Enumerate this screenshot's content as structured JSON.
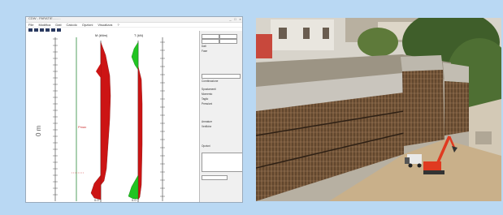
{
  "app": {
    "window_title": "CDW - PARATIE.........",
    "menu": [
      "File",
      "Modifica",
      "Dati",
      "Calcolo",
      "Opzioni",
      "Visualizza",
      "?"
    ],
    "window_buttons": [
      "_",
      "□",
      "×"
    ]
  },
  "plot": {
    "moment_label": "M (kNm)",
    "shear_label": "T (kN)",
    "depth_label": "Prof.",
    "axis_label_1": "0 m",
    "axis_label_2": "Pmax",
    "bottom_label_1": "0.0",
    "bottom_label_2": "0.0"
  },
  "sidepanel": {
    "rows": [
      "Dati",
      "Fase",
      "Combinazione",
      "Spostamenti",
      "Momento",
      "Taglio",
      "Pressioni",
      "Armature",
      "Verifiche",
      "Opzioni"
    ]
  },
  "colors": {
    "background": "#b9d8f3",
    "moment": "#cc1414",
    "shear": "#22c422"
  }
}
